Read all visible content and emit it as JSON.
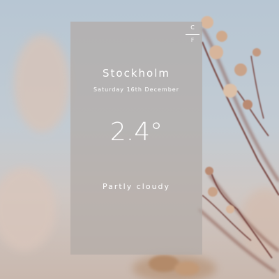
{
  "weather": {
    "city": "Stockholm",
    "date": "Saturday 16th December",
    "temperature": "2.4°",
    "condition": "Partly cloudy"
  },
  "units": {
    "celsius_label": "C",
    "fahrenheit_label": "F",
    "active": "C"
  },
  "colors": {
    "card_background": "#b2aaa6",
    "text": "#ffffff",
    "sky": "#b7c6d3",
    "branch": "#7a4a44"
  },
  "icons": {
    "background": "dried-flower-branch-photo"
  }
}
